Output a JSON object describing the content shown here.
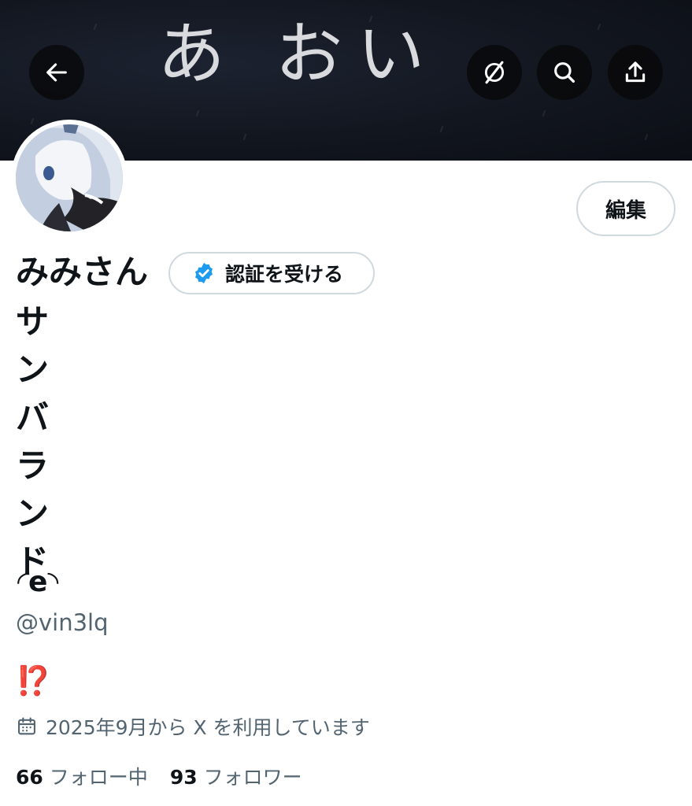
{
  "banner": {
    "text": "あ おい"
  },
  "header": {
    "back_icon": "arrow-left-icon",
    "grok_icon": "grok-slash-circle-icon",
    "search_icon": "search-icon",
    "share_icon": "share-upload-icon"
  },
  "profile": {
    "name_first_line": "みみさん",
    "name_vertical": [
      "サ",
      "ン",
      "バ",
      "ラ",
      "ン",
      "ド"
    ],
    "kaomoji": "◜𝗲◝",
    "handle": "@vin3lq",
    "bio": "⁉️",
    "joined": "2025年9月から X を利用しています",
    "edit_label": "編集",
    "verify_label": "認証を受ける",
    "following_count": "66",
    "following_label": "フォロー中",
    "followers_count": "93",
    "followers_label": "フォロワー"
  },
  "colors": {
    "accent_verified": "#1d9bf0",
    "text_secondary": "#536471",
    "bio_red": "#d4241c"
  }
}
